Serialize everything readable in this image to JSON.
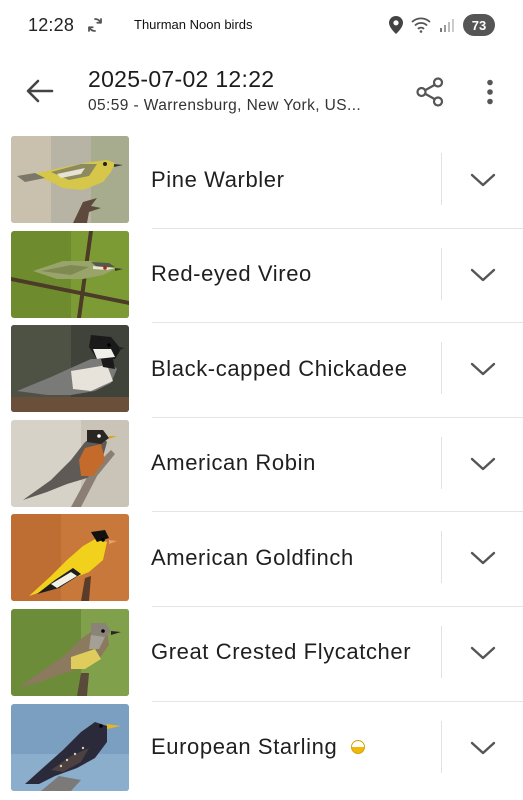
{
  "status_bar": {
    "time": "12:28",
    "notification_title": "Thurman Noon birds",
    "battery": "73"
  },
  "app_bar": {
    "title": "2025-07-02 12:22",
    "subtitle": "05:59 - Warrensburg, New York, US..."
  },
  "icons": {
    "back": "arrow-back-icon",
    "share": "share-icon",
    "more": "more-vert-icon",
    "expand": "chevron-down-icon"
  },
  "species": [
    {
      "name": "Pine Warbler",
      "badge": false
    },
    {
      "name": "Red-eyed Vireo",
      "badge": false
    },
    {
      "name": "Black-capped Chickadee",
      "badge": false
    },
    {
      "name": "American Robin",
      "badge": false
    },
    {
      "name": "American Goldfinch",
      "badge": false
    },
    {
      "name": "Great Crested Flycatcher",
      "badge": false
    },
    {
      "name": "European Starling",
      "badge": true
    }
  ],
  "colors": {
    "badge_fill": "#f0b90a",
    "divider": "#e4e4e4",
    "icon": "#555555"
  }
}
